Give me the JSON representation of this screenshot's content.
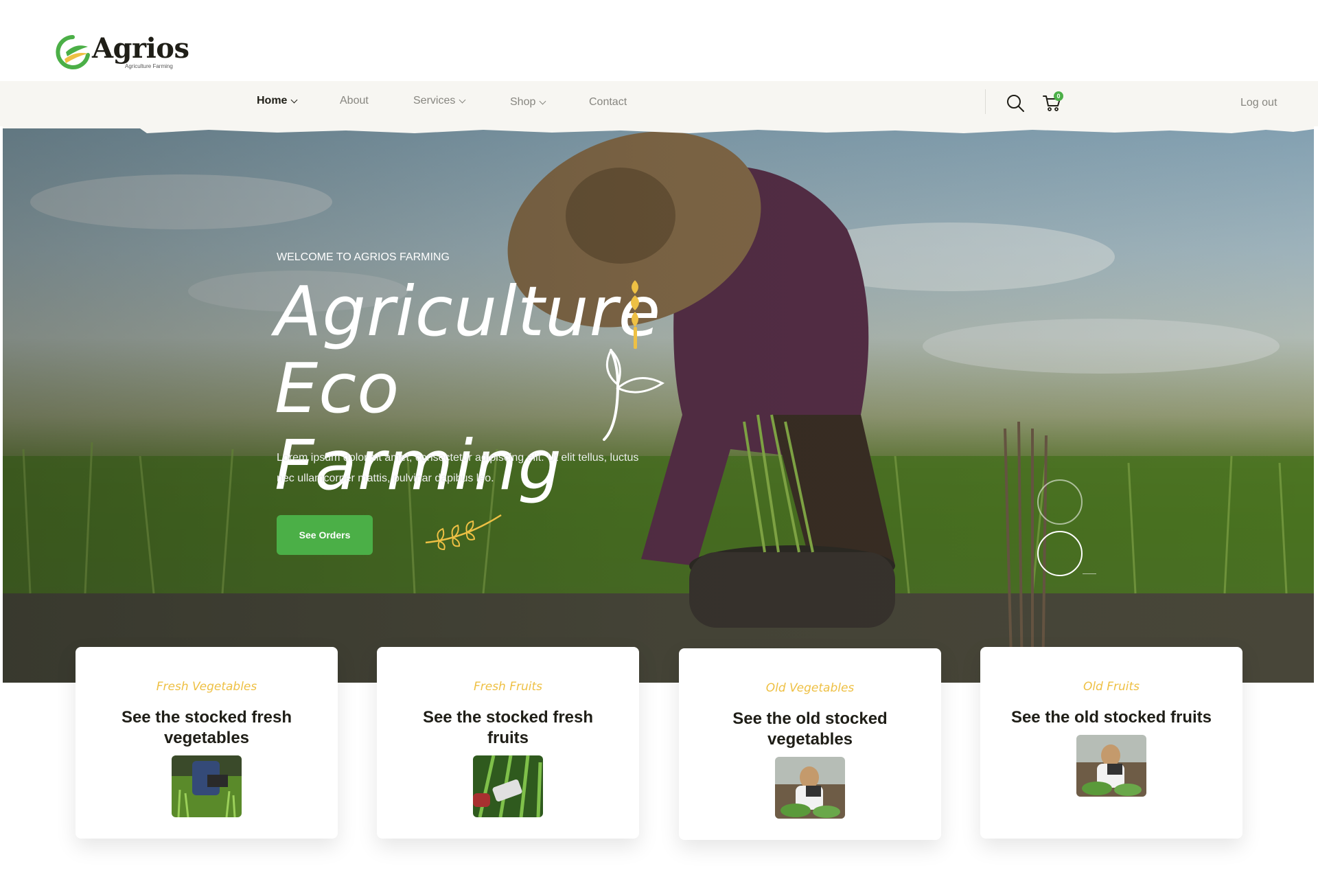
{
  "brand": {
    "name": "Agrios",
    "tagline": "Agriculture Farming"
  },
  "nav": {
    "items": [
      {
        "label": "Home",
        "active": true,
        "dropdown": true
      },
      {
        "label": "About",
        "active": false,
        "dropdown": false
      },
      {
        "label": "Services",
        "active": false,
        "dropdown": true
      },
      {
        "label": "Shop",
        "active": false,
        "dropdown": true
      },
      {
        "label": "Contact",
        "active": false,
        "dropdown": false
      }
    ],
    "search_icon": "search-icon",
    "cart_icon": "cart-icon",
    "cart_count": "0",
    "logout_label": "Log out"
  },
  "hero": {
    "kicker": "WELCOME TO AGRIOS FARMING",
    "title_line1": "Agriculture",
    "title_line2": "Eco Farming",
    "text": "Lorem ipsum dolor sit amet, consectetur adipiscing elit. Ut elit tellus, luctus nec ullamcorper mattis, pulvinar dapibus leo.",
    "button_label": "See Orders"
  },
  "cards": [
    {
      "tag": "Fresh Vegetables",
      "title": "See the stocked fresh vegetables"
    },
    {
      "tag": "Fresh Fruits",
      "title": "See the stocked fresh fruits"
    },
    {
      "tag": "Old Vegetables",
      "title": "See the old stocked vegetables"
    },
    {
      "tag": "Old Fruits",
      "title": "See the old stocked fruits"
    }
  ],
  "colors": {
    "accent_green": "#4baf47",
    "accent_yellow": "#eec044",
    "nav_bg": "#f7f6f2",
    "text_dark": "#1f1e17"
  }
}
